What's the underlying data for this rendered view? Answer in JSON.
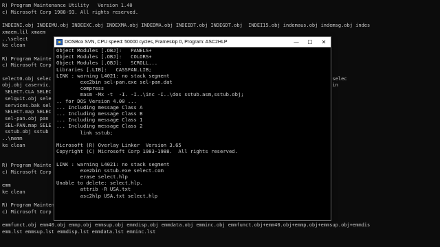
{
  "background_console": {
    "lines": [
      "R) Program Maintenance Utility   Version 1.40",
      "c) Microsoft Corp 1988-93. All rights reserved.",
      "",
      "INDEINI.obj INDEEMU.obj INDEEXC.obj INDEXMA.obj INDEDMA.obj INDEIDT.obj INDEGDT.obj  INDEI15.obj indemaus.obj indemsg.obj indes",
      "xmaem.lil xmaem",
      "..\\select",
      "ke clean",
      "",
      "R) Program Mainte",
      "c) Microsoft Corp",
      "",
      "select0.obj selec                                                                    .obj select7.obj select8.obj selec",
      "obj.obj caservic.                                                                    obj  get_stat.obj global.obj in",
      " SELECT.CLA SELEC",
      " selquit.obj sele",
      " services.bak sel",
      " SELECT.map SELEC",
      " sel-pan.obj pan",
      " SEL-PAN.map SELE",
      " sstub.obj sstub",
      "..\\memm",
      "ke clean",
      "",
      "",
      "R) Program Mainte",
      "c) Microsoft Corp",
      "",
      "emm",
      "ke clean",
      "",
      "R) Program Maintenance Utility   Version 1.40",
      "c) Microsoft Corp 1988-93. All rights reserved.",
      "",
      "emmfunct.obj emm40.obj emmp.obj emmsup.obj emmdisp.obj emmdata.obj emminc.obj emmfunct.obj+emm40.obj+emmp.obj+emmsup.obj+emmdis",
      "emm.lst emmsup.lst emmdisp.lst emmdata.lst emminc.lst"
    ]
  },
  "dosbox": {
    "title": "DOSBox SVN, CPU speed:     50000 cycles, Frameskip  0, Program:  ASC2HLP",
    "icon": "dosbox-icon",
    "buttons": {
      "minimize": "—",
      "maximize": "☐",
      "close": "✕"
    },
    "lines": [
      "Object Modules [.OBJ]:   PANELS+",
      "Object Modules [.OBJ]:   COLORS+",
      "Object Modules [.OBJ]:   SCROLL...",
      "Libraries [.LIB]:   CASSFAN.LIB;",
      "LINK : warning L4021: no stack segment",
      "        exe2bin sel-pan.exe sel-pan.dat",
      "        compress",
      "        masm -Mx -t  -I. -I..\\inc -I..\\dos sstub.asm,sstub.obj;",
      ".. for DOS Version 4.00 ...",
      "... Including message Class A",
      "... Including message Class B",
      "... Including message Class 1",
      "... Including message Class 2",
      "        link sstub;",
      "",
      "Microsoft (R) Overlay Linker  Version 3.65",
      "Copyright (C) Microsoft Corp 1983-1988.  All rights reserved.",
      "",
      "LINK : warning L4021: no stack segment",
      "        exe2bin sstub.exe select.com",
      "        erase select.hlp",
      "Unable to delete: select.hlp.",
      "        attrib -R USA.txt",
      "        asc2hlp USA.txt select.hlp"
    ]
  }
}
